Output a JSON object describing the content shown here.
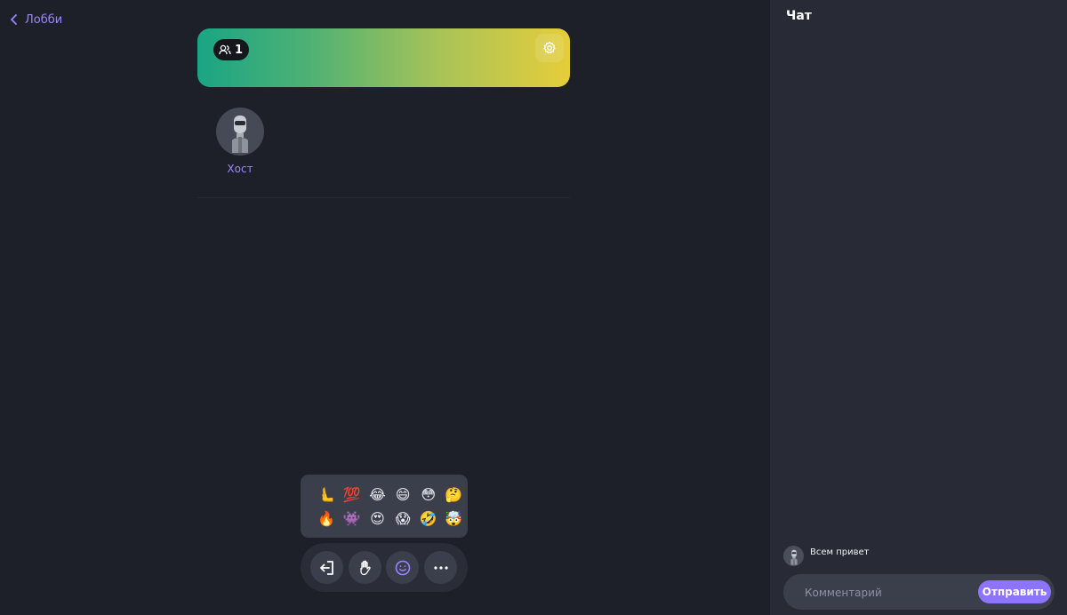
{
  "nav": {
    "back_label": "Лобби",
    "back_icon": "chevron-left-icon"
  },
  "room": {
    "participant_count": "1",
    "banner_gradient": [
      "#1aa585",
      "#e6cd3a"
    ],
    "settings_icon": "gear-icon"
  },
  "participants": [
    {
      "name": "Хост",
      "avatar": "robot-avatar"
    }
  ],
  "reactions": {
    "emojis": [
      "🫷",
      "💯",
      "😂",
      "😄",
      "😳",
      "🤔",
      "🔥",
      "👾",
      "😍",
      "😱",
      "🤣",
      "🤯"
    ]
  },
  "controls": [
    {
      "icon": "leave-icon"
    },
    {
      "icon": "raise-hand-icon"
    },
    {
      "icon": "emoji-icon",
      "active": true
    },
    {
      "icon": "more-icon"
    }
  ],
  "chat": {
    "title": "Чат",
    "messages": [
      {
        "text": "Всем привет",
        "avatar": "robot-avatar"
      }
    ],
    "input_placeholder": "Комментарий",
    "send_label": "Отправить"
  },
  "colors": {
    "accent": "#8d74ff",
    "link": "#9b86ff",
    "background": "#1e2029",
    "sidebar": "#282b36"
  }
}
